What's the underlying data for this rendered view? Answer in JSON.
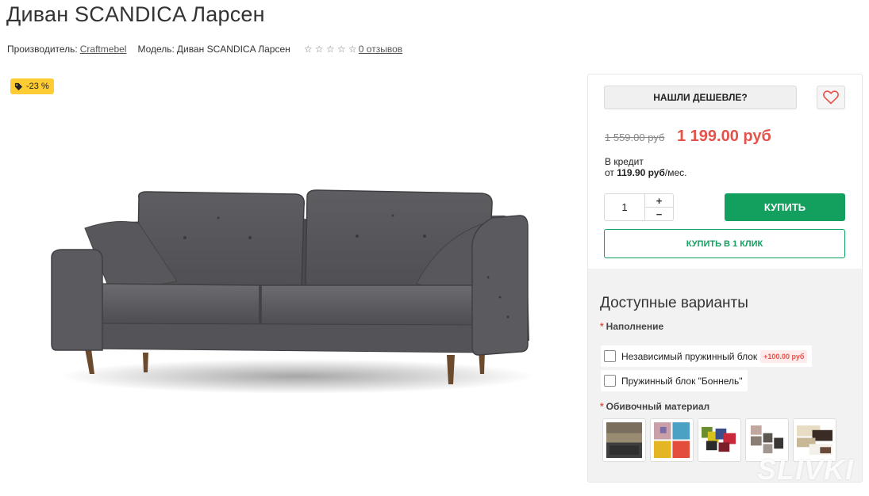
{
  "product": {
    "title": "Диван SCANDICA Ларсен",
    "manufacturer_label": "Производитель:",
    "manufacturer_value": "Craftmebel",
    "model_label": "Модель:",
    "model_value": "Диван SCANDICA Ларсен",
    "rating": 0,
    "rating_max": 5,
    "reviews_link": "0 отзывов",
    "discount_badge": "-23 %",
    "image_icon": "sofa-photo"
  },
  "purchase": {
    "cheaper_button": "НАШЛИ ДЕШЕВЛЕ?",
    "favorite_icon": "heart-icon",
    "old_price": "1 559.00 руб",
    "new_price": "1 199.00 руб",
    "credit_line1": "В кредит",
    "credit_prefix": "от ",
    "credit_amount": "119.90 руб",
    "credit_suffix": "/мес.",
    "quantity": "1",
    "qty_plus": "+",
    "qty_minus": "−",
    "buy_button": "КУПИТЬ",
    "one_click_button": "КУПИТЬ В 1 КЛИК",
    "accent_color": "#13a05f",
    "price_color": "#e4534b"
  },
  "variants": {
    "title": "Доступные варианты",
    "filling_label": "Наполнение",
    "filling_options": [
      {
        "label": "Независимый пружинный блок",
        "surcharge": "+100.00 руб",
        "checked": false
      },
      {
        "label": "Пружинный блок \"Боннель\"",
        "surcharge": "",
        "checked": false
      }
    ],
    "upholstery_label": "Обивочный материал",
    "upholstery_swatches": [
      "fabric-swatch-1",
      "fabric-swatch-2",
      "fabric-swatch-3",
      "fabric-swatch-4",
      "fabric-swatch-5"
    ],
    "required_mark": "*"
  },
  "watermark": "SLIVKI"
}
